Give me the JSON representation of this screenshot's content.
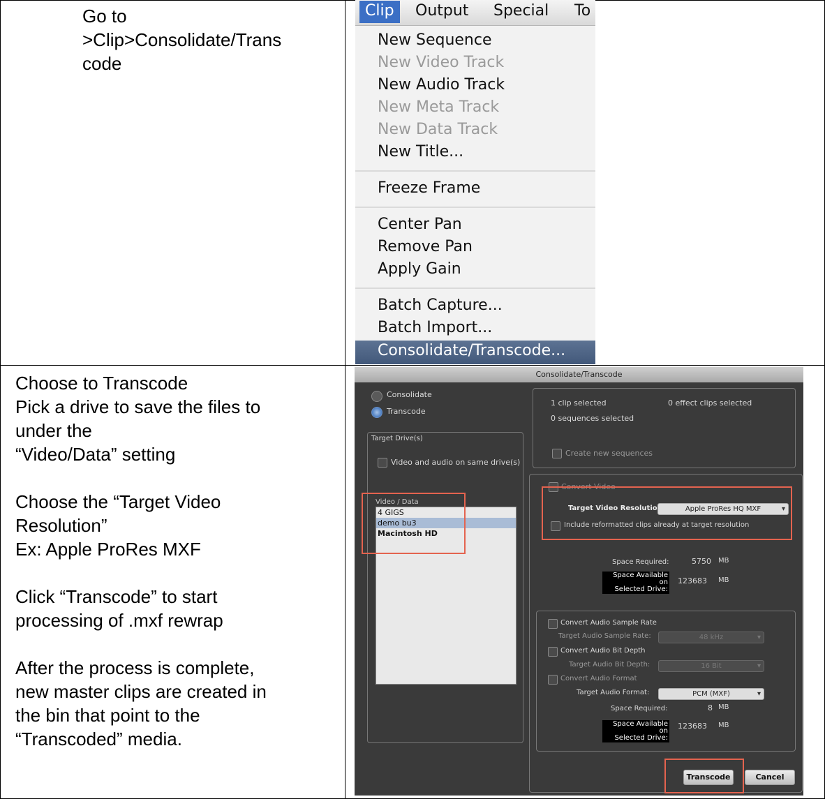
{
  "instructions": {
    "step1_lines": [
      "Go to",
      ">Clip>Consolidate/Trans",
      "code"
    ],
    "step2_lines": [
      "Choose to Transcode",
      "Pick a drive to save the files to",
      "under the",
      "“Video/Data” setting",
      "",
      "Choose the “Target Video",
      "Resolution”",
      "Ex: Apple ProRes MXF",
      "",
      "Click “Transcode” to start",
      "processing of .mxf rewrap",
      "",
      "After the process is complete,",
      "new master clips are created in",
      "the bin that point to the",
      "“Transcoded” media."
    ]
  },
  "menu": {
    "bar": [
      "Clip",
      "Output",
      "Special",
      "To"
    ],
    "items": [
      {
        "label": "New Sequence",
        "enabled": true
      },
      {
        "label": "New Video Track",
        "enabled": false
      },
      {
        "label": "New Audio Track",
        "enabled": true
      },
      {
        "label": "New Meta Track",
        "enabled": false
      },
      {
        "label": "New Data Track",
        "enabled": false
      },
      {
        "label": "New Title...",
        "enabled": true
      },
      {
        "label": "Freeze Frame",
        "enabled": true
      },
      {
        "label": "Center Pan",
        "enabled": true
      },
      {
        "label": "Remove Pan",
        "enabled": true
      },
      {
        "label": "Apply Gain",
        "enabled": true
      },
      {
        "label": "Batch Capture...",
        "enabled": true
      },
      {
        "label": "Batch Import...",
        "enabled": true
      }
    ],
    "selected_item": "Consolidate/Transcode..."
  },
  "dialog": {
    "title": "Consolidate/Transcode",
    "mode_consolidate": "Consolidate",
    "mode_transcode": "Transcode",
    "target_drives_label": "Target Drive(s)",
    "same_drive_label": "Video and audio on same drive(s)",
    "list_header": "Video / Data",
    "drives": [
      "4 GIGS",
      "demo bu3",
      "Macintosh HD"
    ],
    "selection_info": {
      "clips": "1 clip selected",
      "effect_clips": "0 effect clips selected",
      "sequences": "0 sequences selected",
      "create_sequences": "Create new sequences"
    },
    "video": {
      "convert_label": "Convert Video",
      "target_res_label": "Target Video Resolution:",
      "target_res_value": "Apple ProRes HQ  MXF",
      "include_label": "Include reformatted clips already at target resolution",
      "space_required_label": "Space Required:",
      "space_required_value": "5750",
      "space_available_label_1": "Space Available on",
      "space_available_label_2": "Selected Drive:",
      "space_available_value": "123683",
      "unit": "MB"
    },
    "audio": {
      "convert_rate_label": "Convert Audio Sample Rate",
      "target_rate_label": "Target Audio Sample Rate:",
      "target_rate_value": "48 kHz",
      "convert_depth_label": "Convert Audio Bit Depth",
      "target_depth_label": "Target Audio Bit Depth:",
      "target_depth_value": "16 Bit",
      "convert_format_label": "Convert Audio Format",
      "target_format_label": "Target Audio Format:",
      "target_format_value": "PCM  (MXF)",
      "space_required_label": "Space Required:",
      "space_required_value": "8",
      "space_available_label_1": "Space Available on",
      "space_available_label_2": "Selected Drive:",
      "space_available_value": "123683",
      "unit": "MB"
    },
    "buttons": {
      "transcode": "Transcode",
      "cancel": "Cancel"
    }
  }
}
